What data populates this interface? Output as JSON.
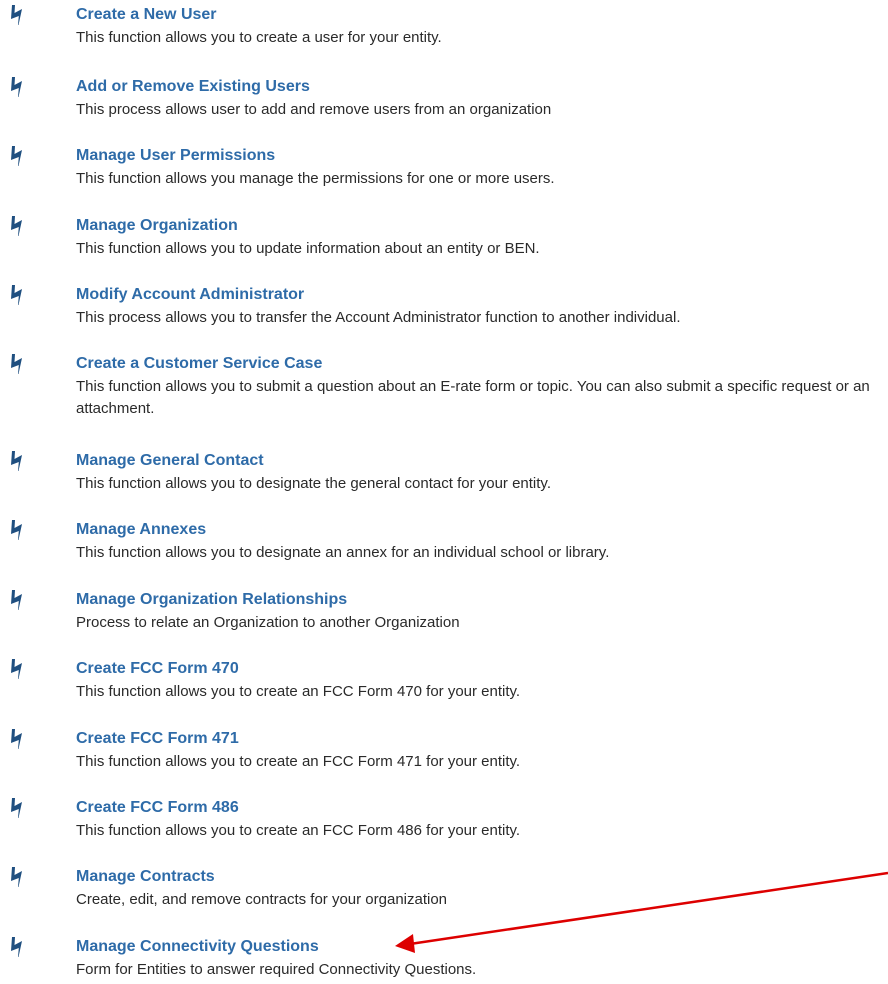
{
  "tasks": [
    {
      "title": "Create a New User",
      "description": "This function allows you to create a user for your entity.",
      "icon": "lightning-bolt-icon"
    },
    {
      "title": "Add or Remove Existing Users",
      "description": "This process allows user to add and remove users from an organization",
      "icon": "lightning-bolt-icon"
    },
    {
      "title": "Manage User Permissions",
      "description": "This function allows you manage the permissions for one or more users.",
      "icon": "lightning-bolt-icon"
    },
    {
      "title": "Manage Organization",
      "description": "This function allows you to update information about an entity or BEN.",
      "icon": "lightning-bolt-icon"
    },
    {
      "title": "Modify Account Administrator",
      "description": "This process allows you to transfer the Account Administrator function to another individual.",
      "icon": "lightning-bolt-icon"
    },
    {
      "title": "Create a Customer Service Case",
      "description": "This function allows you to submit a question about an E-rate form or topic. You can also submit a specific request or an attachment.",
      "icon": "lightning-bolt-icon"
    },
    {
      "title": "Manage General Contact",
      "description": "This function allows you to designate the general contact for your entity.",
      "icon": "lightning-bolt-icon"
    },
    {
      "title": "Manage Annexes",
      "description": "This function allows you to designate an annex for an individual school or library.",
      "icon": "lightning-bolt-icon"
    },
    {
      "title": "Manage Organization Relationships",
      "description": "Process to relate an Organization to another Organization",
      "icon": "lightning-bolt-icon"
    },
    {
      "title": "Create FCC Form 470",
      "description": "This function allows you to create an FCC Form 470 for your entity.",
      "icon": "lightning-bolt-icon"
    },
    {
      "title": "Create FCC Form 471",
      "description": "This function allows you to create an FCC Form 471 for your entity.",
      "icon": "lightning-bolt-icon"
    },
    {
      "title": "Create FCC Form 486",
      "description": "This function allows you to create an FCC Form 486 for your entity.",
      "icon": "lightning-bolt-icon"
    },
    {
      "title": "Manage Contracts",
      "description": "Create, edit, and remove contracts for your organization",
      "icon": "lightning-bolt-icon"
    },
    {
      "title": "Manage Connectivity Questions",
      "description": "Form for Entities to answer required Connectivity Questions.",
      "icon": "lightning-bolt-icon"
    }
  ],
  "colors": {
    "link": "#2e6ba8",
    "text": "#2a2a2a",
    "icon": "#1f4f80",
    "annotation_arrow": "#dd0000"
  },
  "annotation": {
    "type": "arrow",
    "icon": "red-arrow-icon"
  }
}
